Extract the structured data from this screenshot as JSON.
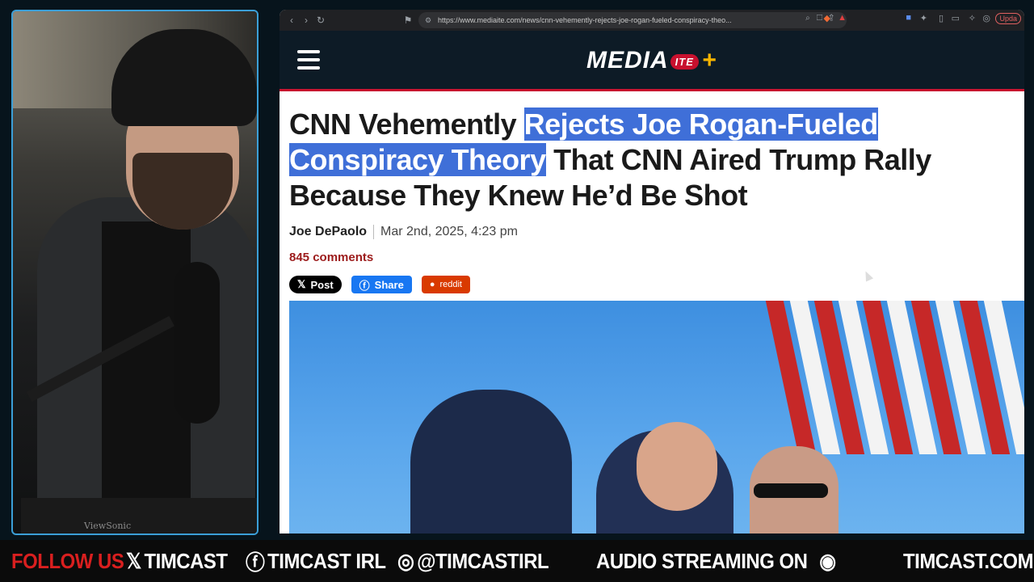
{
  "browser": {
    "url": "https://www.mediaite.com/news/cnn-vehemently-rejects-joe-rogan-fueled-conspiracy-theo...",
    "update_label": "Upda"
  },
  "site": {
    "logo_main": "MEDIA",
    "logo_badge": "ITE",
    "logo_plus": "+"
  },
  "article": {
    "headline_part1": "CNN Vehemently ",
    "headline_highlight": "Rejects Joe Rogan-Fueled Conspiracy Theory",
    "headline_part2": " That CNN Aired Trump Rally Because They Knew He’d Be Shot",
    "author": "Joe DePaolo",
    "date": "Mar 2nd, 2025, 4:23 pm",
    "comments": "845 comments",
    "share_x": "Post",
    "share_fb": "Share",
    "share_reddit": "reddit"
  },
  "webcam": {
    "monitor_brand": "ViewSonic"
  },
  "ticker": {
    "follow": "FOLLOW US",
    "x_handle": "TIMCAST",
    "fb_handle": "TIMCAST IRL",
    "ig_handle": "@TIMCASTIRL",
    "audio": "AUDIO STREAMING ON",
    "site": "TIMCAST.COM"
  },
  "colors": {
    "accent_red": "#c8102e",
    "highlight_blue": "#3f6fd8",
    "frame_blue": "#3b9fd8"
  }
}
